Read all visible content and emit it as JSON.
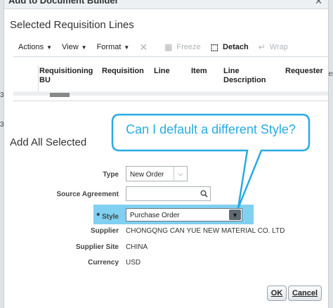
{
  "window": {
    "title": "Add to Document Builder"
  },
  "selected_lines": {
    "title": "Selected Requisition Lines",
    "toolbar": {
      "actions": "Actions",
      "view": "View",
      "format": "Format",
      "freeze": "Freeze",
      "detach": "Detach",
      "wrap": "Wrap"
    },
    "columns": [
      "Requisitioning BU",
      "Requisition",
      "Line",
      "Item",
      "Line Description",
      "Requester"
    ]
  },
  "add_all": {
    "title": "Add All Selected",
    "type_label": "Type",
    "type_value": "New Order",
    "source_agreement_label": "Source Agreement",
    "source_agreement_value": "",
    "style_required": "*",
    "style_label": "Style",
    "style_value": "Purchase Order",
    "supplier_label": "Supplier",
    "supplier_value": "CHONGQNG CAN YUE NEW MATERIAL CO. LTD",
    "supplier_site_label": "Supplier Site",
    "supplier_site_value": "CHINA",
    "currency_label": "Currency",
    "currency_value": "USD"
  },
  "callout": {
    "text": "Can I default a different Style?",
    "color": "#29abe2"
  },
  "buttons": {
    "ok": "OK",
    "cancel": "Cancel"
  },
  "edge": {
    "left_digit_1": "3",
    "left_digit_2": "3",
    "right_text": "les"
  }
}
